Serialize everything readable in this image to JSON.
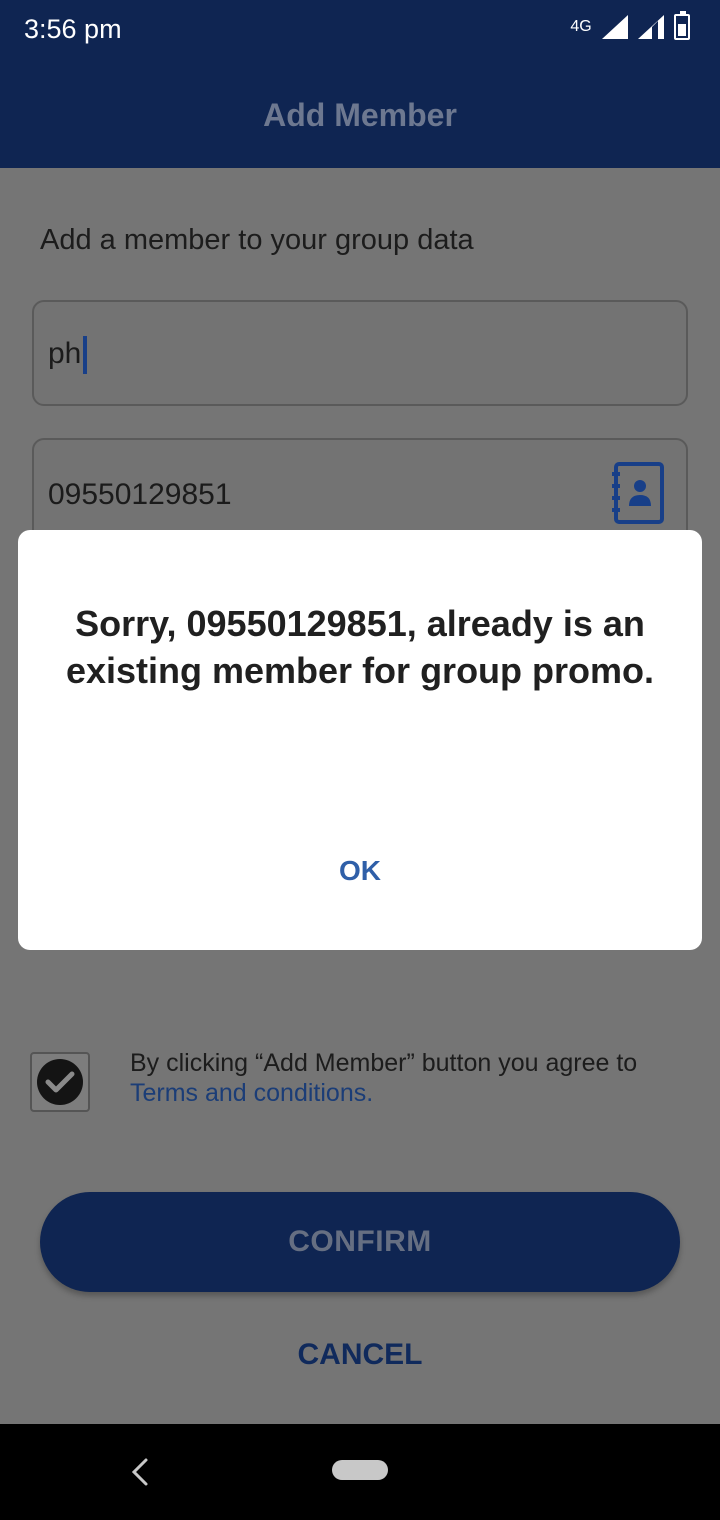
{
  "status_bar": {
    "time": "3:56 pm",
    "network": "4G",
    "icons": [
      "network-type-icon",
      "signal-icon",
      "signal-icon",
      "battery-icon"
    ]
  },
  "app_bar": {
    "title": "Add Member"
  },
  "form": {
    "intro": "Add a member to your group data",
    "name_value": "ph",
    "phone_value": "09550129851",
    "contact_icon": "contact-book-icon"
  },
  "agreement": {
    "text": "By clicking “Add Member” button you agree to",
    "link": "Terms and conditions.",
    "checked": true
  },
  "actions": {
    "confirm": "CONFIRM",
    "cancel": "CANCEL"
  },
  "dialog": {
    "message": "Sorry, 09550129851, already is an existing member for group promo.",
    "ok_label": "OK"
  },
  "colors": {
    "primary": "#0f2552",
    "link": "#2f5fa8",
    "dialog_bg": "#ffffff"
  }
}
